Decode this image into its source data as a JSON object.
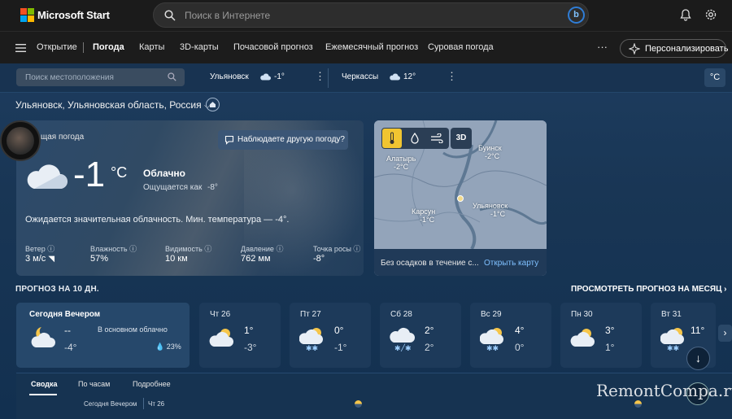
{
  "header": {
    "brand": "Microsoft Start",
    "search_placeholder": "Поиск в Интернете",
    "bing": "b"
  },
  "nav": {
    "items": [
      "Открытие",
      "Погода",
      "Карты",
      "3D-карты",
      "Почасовой прогноз",
      "Ежемесячный прогноз",
      "Суровая погода"
    ],
    "more": "···",
    "personalize": "Персонализировать"
  },
  "locbar": {
    "placeholder": "Поиск местоположения",
    "cities": [
      {
        "name": "Ульяновск",
        "temp": "-1°"
      },
      {
        "name": "Черкассы",
        "temp": "12°"
      }
    ],
    "unit": "°C"
  },
  "location": "Ульяновск, Ульяновская область, Россия",
  "current": {
    "title": "щая погода",
    "other_weather": "Наблюдаете другую погоду?",
    "temp": "-1",
    "unit": "°C",
    "condition": "Облачно",
    "feels_label": "Ощущается как",
    "feels_value": "-8°",
    "summary": "Ожидается значительная облачность. Мин. температура — -4°.",
    "stats": [
      {
        "label": "Ветер",
        "value": "3 м/с"
      },
      {
        "label": "Влажность",
        "value": "57%"
      },
      {
        "label": "Видимость",
        "value": "10 км"
      },
      {
        "label": "Давление",
        "value": "762 мм"
      },
      {
        "label": "Точка росы",
        "value": "-8°"
      }
    ]
  },
  "map": {
    "btn_3d": "3D",
    "labels": [
      {
        "name": "Алатырь",
        "temp": "-2°C"
      },
      {
        "name": "Буинск",
        "temp": "-2°C"
      },
      {
        "name": "Карсун",
        "temp": "-1°C"
      },
      {
        "name": "Ульяновск",
        "temp": "-1°C"
      }
    ],
    "foot": "Без осадков в течение с...",
    "open": "Открыть карту"
  },
  "forecast": {
    "title": "ПРОГНОЗ НА 10 ДН.",
    "month_link": "ПРОСМОТРЕТЬ ПРОГНОЗ НА МЕСЯЦ ›",
    "today": {
      "name": "Сегодня Вечером",
      "hi": "--",
      "lo": "-4°",
      "cond": "В основном облачно",
      "precip": "23%"
    },
    "days": [
      {
        "name": "Чт 26",
        "hi": "1°",
        "lo": "-3°",
        "icon": "sun-cloud"
      },
      {
        "name": "Пт 27",
        "hi": "0°",
        "lo": "-1°",
        "icon": "snow"
      },
      {
        "name": "Сб 28",
        "hi": "2°",
        "lo": "2°",
        "icon": "rain-snow"
      },
      {
        "name": "Вс 29",
        "hi": "4°",
        "lo": "0°",
        "icon": "snow"
      },
      {
        "name": "Пн 30",
        "hi": "3°",
        "lo": "1°",
        "icon": "sun-cloud"
      },
      {
        "name": "Вт 31",
        "hi": "11°",
        "lo": "",
        "icon": "snow"
      }
    ]
  },
  "bottom": {
    "tabs": [
      "Сводка",
      "По часам",
      "Подробнее"
    ],
    "row_today": "Сегодня Вечером",
    "row_day": "Чт 26"
  },
  "watermark": "RemontCompa.ru"
}
